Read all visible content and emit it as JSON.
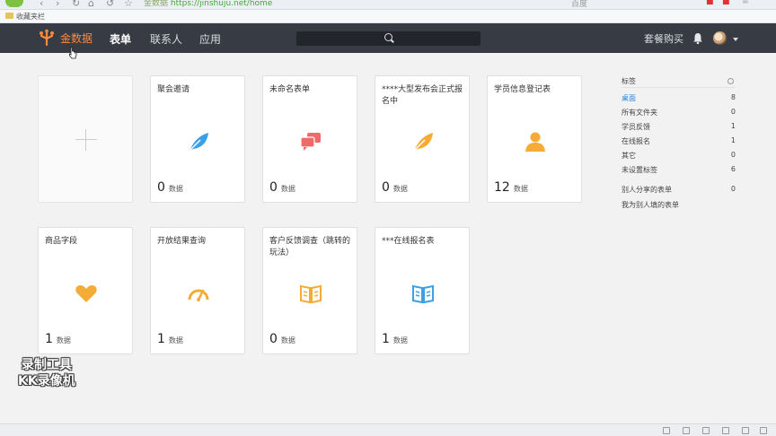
{
  "browser": {
    "address_prefix": "金数据",
    "address_url": "https://jinshuju.net/home",
    "bookmarks_label": "收藏夹栏",
    "toolbar_text": "百度"
  },
  "navbar": {
    "brand_label": "金数据",
    "items": [
      {
        "label": "表单",
        "active": true
      },
      {
        "label": "联系人",
        "active": false
      },
      {
        "label": "应用",
        "active": false
      }
    ],
    "pricing_label": "套餐购买"
  },
  "forms": [
    {
      "title": "聚会邀请",
      "count": "0",
      "unit": "数据",
      "icon": "leaf-icon",
      "color": "#3aa0e8"
    },
    {
      "title": "未命名表单",
      "count": "0",
      "unit": "数据",
      "icon": "chat-bubbles-icon",
      "color": "#f06a6a"
    },
    {
      "title": "****大型发布会正式报名中",
      "count": "0",
      "unit": "数据",
      "icon": "leaf-icon",
      "color": "#f5ac36"
    },
    {
      "title": "学员信息登记表",
      "count": "12",
      "unit": "数据",
      "icon": "person-icon",
      "color": "#f5ac36"
    },
    {
      "title": "商品字段",
      "count": "1",
      "unit": "数据",
      "icon": "heart-icon",
      "color": "#f5ac36"
    },
    {
      "title": "开放结果查询",
      "count": "1",
      "unit": "数据",
      "icon": "gauge-icon",
      "color": "#f5ac36"
    },
    {
      "title": "客户反馈调查（跳转的玩法）",
      "count": "0",
      "unit": "数据",
      "icon": "book-icon",
      "color": "#f5ac36"
    },
    {
      "title": "***在线报名表",
      "count": "1",
      "unit": "数据",
      "icon": "book-icon",
      "color": "#3aa0e8"
    }
  ],
  "tags_panel": {
    "header": "标签",
    "tags": [
      {
        "label": "桌面",
        "count": "8",
        "active": true
      },
      {
        "label": "所有文件夹",
        "count": "0",
        "active": false
      },
      {
        "label": "学员反馈",
        "count": "1",
        "active": false
      },
      {
        "label": "在线报名",
        "count": "1",
        "active": false
      },
      {
        "label": "其它",
        "count": "0",
        "active": false
      },
      {
        "label": "未设置标签",
        "count": "6",
        "active": false
      }
    ],
    "shared_label": "别人分享的表单",
    "shared_count": "0",
    "filled_label": "我为别人填的表单"
  },
  "watermark": {
    "line1": "录制工具",
    "line2": "KK录像机"
  },
  "colors": {
    "navbar": "#373b44",
    "brand_accent": "#ff8a3d",
    "link_active": "#2a86d8"
  }
}
